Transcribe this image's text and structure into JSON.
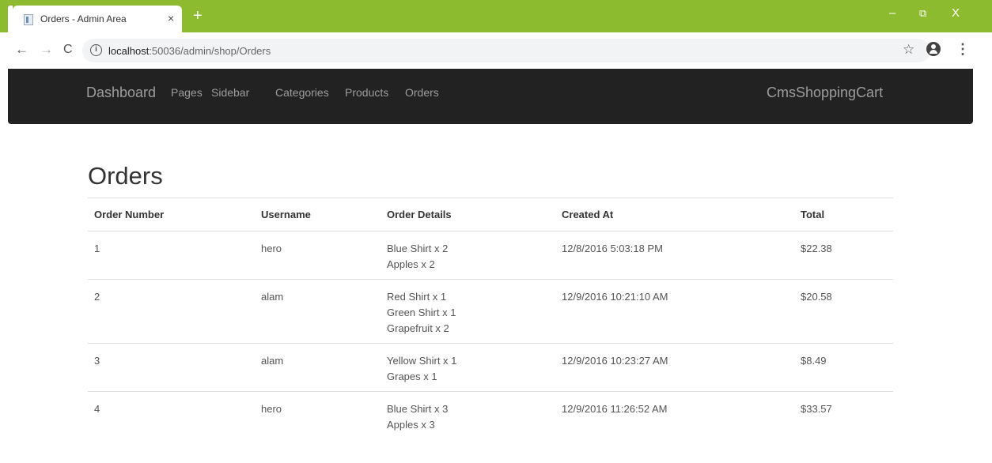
{
  "browser": {
    "tab_title": "Orders - Admin Area",
    "tab_close": "×",
    "new_tab": "+",
    "window_buttons": {
      "minimize": "–",
      "maximize": "⧉",
      "close": "X"
    },
    "url_host": "localhost",
    "url_rest": ":50036/admin/shop/Orders",
    "icons": [
      "back-arrow-icon",
      "forward-arrow-icon",
      "reload-icon",
      "info-icon",
      "star-icon",
      "profile-icon",
      "kebab-menu-icon"
    ]
  },
  "navbar": {
    "brand": "Dashboard",
    "links": [
      "Pages",
      "Sidebar",
      "Categories",
      "Products",
      "Orders"
    ],
    "site_name": "CmsShoppingCart",
    "background": "#222222",
    "link_color": "#9d9d9d"
  },
  "page": {
    "title": "Orders"
  },
  "table": {
    "headers": [
      "Order Number",
      "Username",
      "Order Details",
      "Created At",
      "Total"
    ],
    "rows": [
      {
        "number": "1",
        "username": "hero",
        "details": [
          "Blue Shirt x 2",
          "Apples x 2"
        ],
        "created": "12/8/2016 5:03:18 PM",
        "total": "$22.38"
      },
      {
        "number": "2",
        "username": "alam",
        "details": [
          "Red Shirt x 1",
          "Green Shirt x 1",
          "Grapefruit x 2"
        ],
        "created": "12/9/2016 10:21:10 AM",
        "total": "$20.58"
      },
      {
        "number": "3",
        "username": "alam",
        "details": [
          "Yellow Shirt x 1",
          "Grapes x 1"
        ],
        "created": "12/9/2016 10:23:27 AM",
        "total": "$8.49"
      },
      {
        "number": "4",
        "username": "hero",
        "details": [
          "Blue Shirt x 3",
          "Apples x 3"
        ],
        "created": "12/9/2016 11:26:52 AM",
        "total": "$33.57"
      }
    ]
  },
  "colors": {
    "chrome_accent": "#8dbb2f"
  }
}
